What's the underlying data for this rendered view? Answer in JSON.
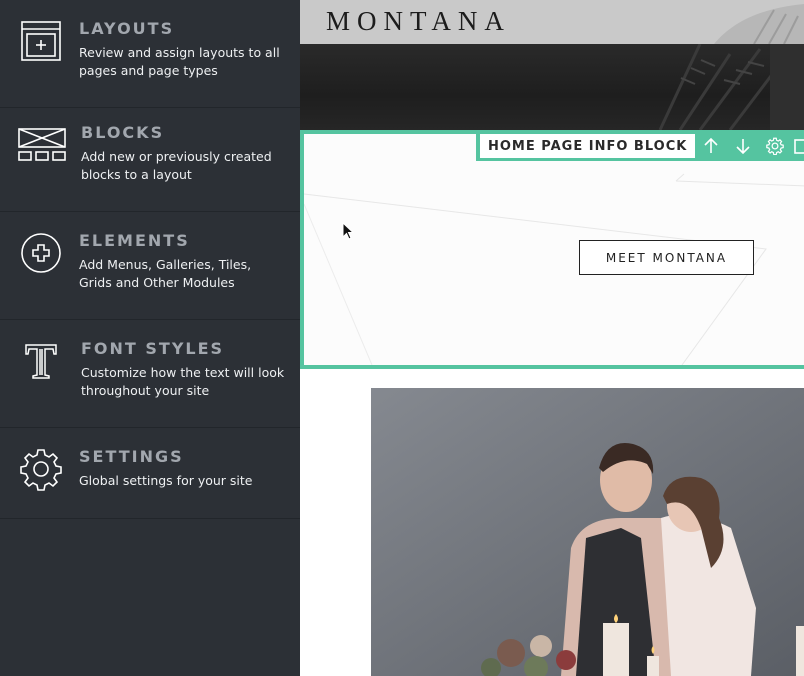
{
  "sidebar": {
    "items": [
      {
        "title": "LAYOUTS",
        "desc": "Review and assign layouts to all pages and page types",
        "icon": "layout-icon"
      },
      {
        "title": "BLOCKS",
        "desc": "Add new or previously created blocks to a layout",
        "icon": "blocks-icon"
      },
      {
        "title": "ELEMENTS",
        "desc": "Add Menus, Galleries, Tiles, Grids and Other Modules",
        "icon": "plus-circle-icon"
      },
      {
        "title": "FONT STYLES",
        "desc": "Customize how the text will look throughout your site",
        "icon": "font-t-icon"
      },
      {
        "title": "SETTINGS",
        "desc": "Global settings for your site",
        "icon": "gear-icon"
      }
    ]
  },
  "preview": {
    "site_logo": "MONTANA",
    "block_label": "HOME PAGE INFO BLOCK",
    "toolbar_icons": [
      "arrow-up-icon",
      "arrow-down-icon",
      "gear-icon",
      "copy-icon"
    ],
    "cta_label": "MEET MONTANA"
  },
  "colors": {
    "sidebar_bg": "#2c3036",
    "accent": "#55c4a0",
    "title_text": "#a2a7ae",
    "desc_text": "#eef0f2"
  }
}
